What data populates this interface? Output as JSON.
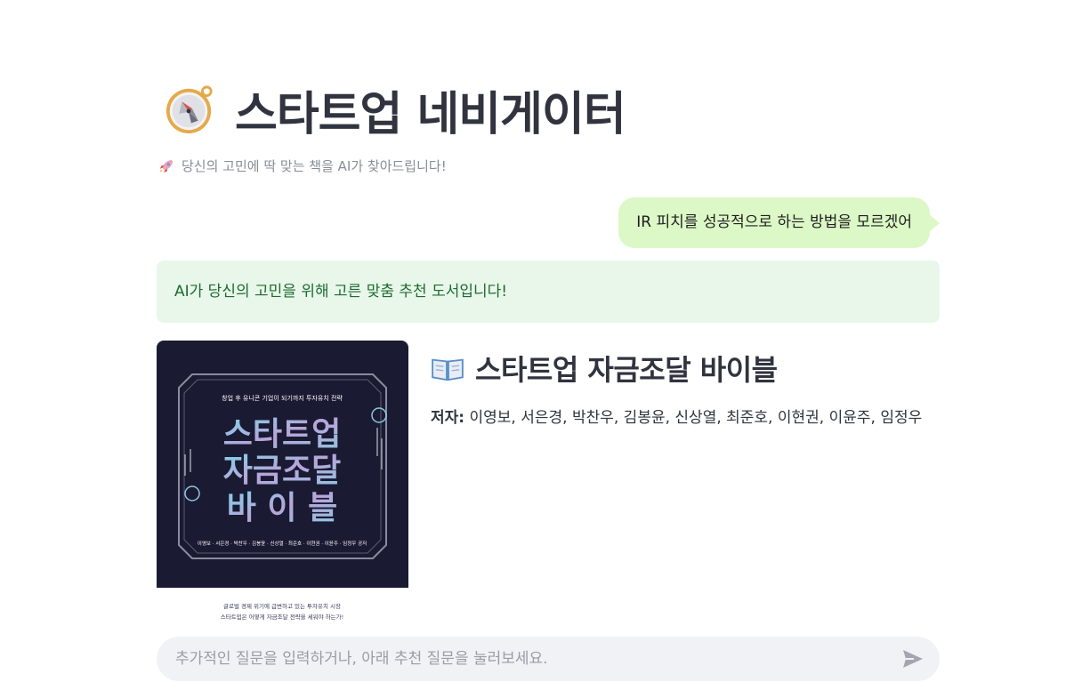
{
  "header": {
    "title": "스타트업 네비게이터",
    "title_icon": "compass-icon",
    "subtitle": "당신의 고민에 딱 맞는 책을 AI가 찾아드립니다!",
    "subtitle_icon": "rocket-icon"
  },
  "chat": {
    "user_message": "IR 피치를 성공적으로 하는 방법을 모르겠어",
    "ai_banner": "AI가 당신의 고민을 위해 고른 맞춤 추천 도서입니다!"
  },
  "book": {
    "title_icon": "open-book-icon",
    "title": "스타트업 자금조달 바이블",
    "author_label": "저자:",
    "authors": "이영보, 서은경, 박찬우, 김봉윤, 신상열, 최준호, 이현권, 이윤주, 임정우",
    "cover": {
      "tagline": "창업 후 유니콘 기업이 되기까지 투자유치 전략",
      "title_lines": [
        "스타트업",
        "자금조달",
        "바 이 블"
      ],
      "authors_line": "이영보 · 서은경 · 박찬우 · 김봉윤 · 신상열 · 최준호 · 이현권 · 이윤주 · 임정우 공저",
      "footer_line1": "글로벌 경제 위기에 급변하고 있는 투자유치 시장",
      "footer_line2": "스타트업은 어떻게 자금조달 전략을 세워야 하는가!"
    }
  },
  "input": {
    "placeholder": "추가적인 질문을 입력하거나, 아래 추천 질문을 눌러보세요.",
    "send_icon": "send-icon"
  },
  "colors": {
    "user_bubble": "#dcf8c6",
    "ai_banner_bg": "#e8f7ea",
    "ai_banner_text": "#1e6b31",
    "cover_bg": "#1a1a33",
    "input_bg": "#f0f2f6"
  }
}
